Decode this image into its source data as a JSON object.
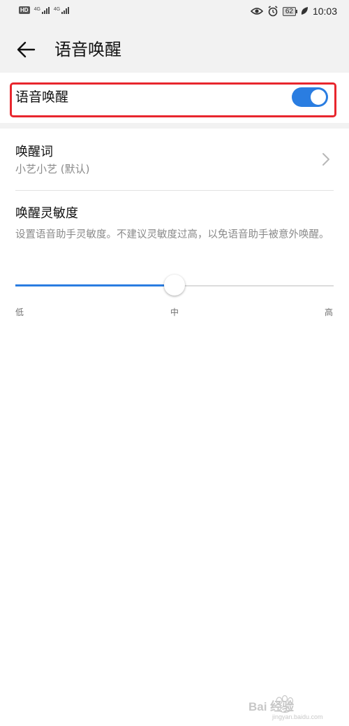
{
  "status_bar": {
    "hd_label": "HD",
    "signal_1_label": "4G",
    "signal_2_label": "4G",
    "battery_level": "62",
    "time": "10:03",
    "icons": [
      "eye-comfort-icon",
      "alarm-icon",
      "battery-icon",
      "leaf-icon"
    ]
  },
  "header": {
    "back_icon": "arrow-left-icon",
    "title": "语音唤醒"
  },
  "voice_wakeup": {
    "label": "语音唤醒",
    "enabled": true
  },
  "wake_word": {
    "title": "唤醒词",
    "value": "小艺小艺 (默认)"
  },
  "sensitivity": {
    "title": "唤醒灵敏度",
    "description": "设置语音助手灵敏度。不建议灵敏度过高，以免语音助手被意外唤醒。",
    "level": 0.5,
    "labels": {
      "low": "低",
      "mid": "中",
      "high": "高"
    }
  },
  "colors": {
    "accent": "#2a7de1",
    "highlight": "#e8262d",
    "background": "#f2f2f2"
  },
  "watermark": {
    "text": "Bai 经验",
    "url_text": "jingyan.baidu.com"
  }
}
